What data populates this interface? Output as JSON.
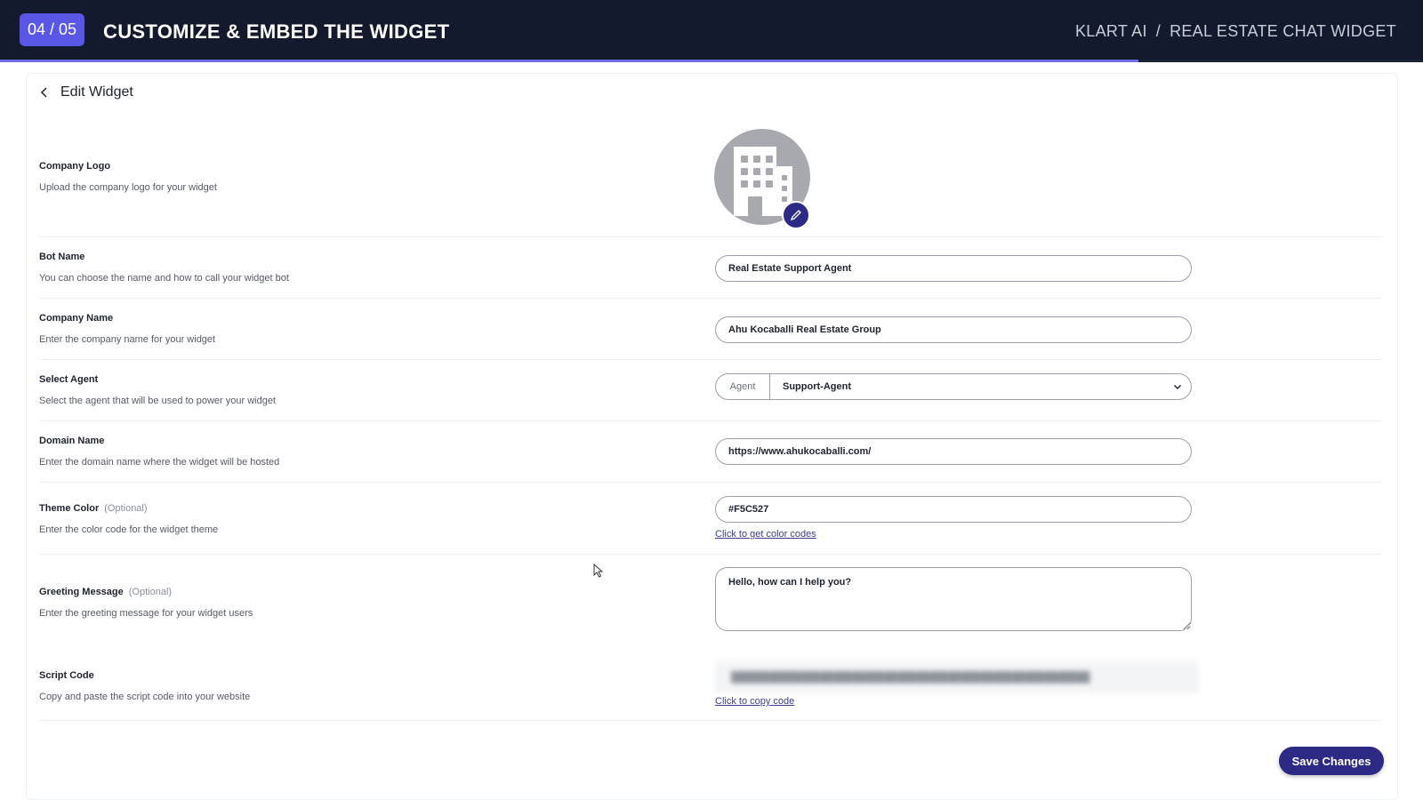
{
  "header": {
    "step": "04 / 05",
    "title": "CUSTOMIZE & EMBED THE WIDGET",
    "breadcrumb": [
      "KLART AI",
      "REAL ESTATE CHAT WIDGET"
    ],
    "separator": "/",
    "progress_fraction": 0.8
  },
  "page": {
    "title": "Edit Widget"
  },
  "logo": {
    "label": "Company Logo",
    "description": "Upload the company logo for your widget"
  },
  "bot_name": {
    "label": "Bot Name",
    "description": "You can choose the name and how to call your widget bot",
    "value": "Real Estate Support Agent"
  },
  "company_name": {
    "label": "Company Name",
    "description": "Enter the company name for your widget",
    "value": "Ahu Kocaballi Real Estate Group"
  },
  "agent": {
    "label": "Select Agent",
    "description": "Select the agent that will be used to power your widget",
    "prefix": "Agent",
    "value": "Support-Agent"
  },
  "domain": {
    "label": "Domain Name",
    "description": "Enter the domain name where the widget will be hosted",
    "value": "https://www.ahukocaballi.com/"
  },
  "theme": {
    "label": "Theme Color",
    "optional": "(Optional)",
    "description": "Enter the color code for the widget theme",
    "value": "#F5C527",
    "link": "Click to get color codes"
  },
  "greeting": {
    "label": "Greeting Message",
    "optional": "(Optional)",
    "description": "Enter the greeting message for your widget users",
    "value": "Hello, how can I help you?"
  },
  "script": {
    "label": "Script Code",
    "description": "Copy and paste the script code into your website",
    "link": "Click to copy code"
  },
  "save_label": "Save Changes",
  "colors": {
    "banner_bg": "#141a2e",
    "step_badge": "#5b57e6",
    "primary_button": "#2c2a85",
    "progress": "#6f6bf0"
  },
  "icons": {
    "back": "chevron-left-icon",
    "logo": "building-icon",
    "edit": "pencil-icon",
    "select": "chevron-down-icon",
    "pointer": "mouse-cursor-icon"
  }
}
